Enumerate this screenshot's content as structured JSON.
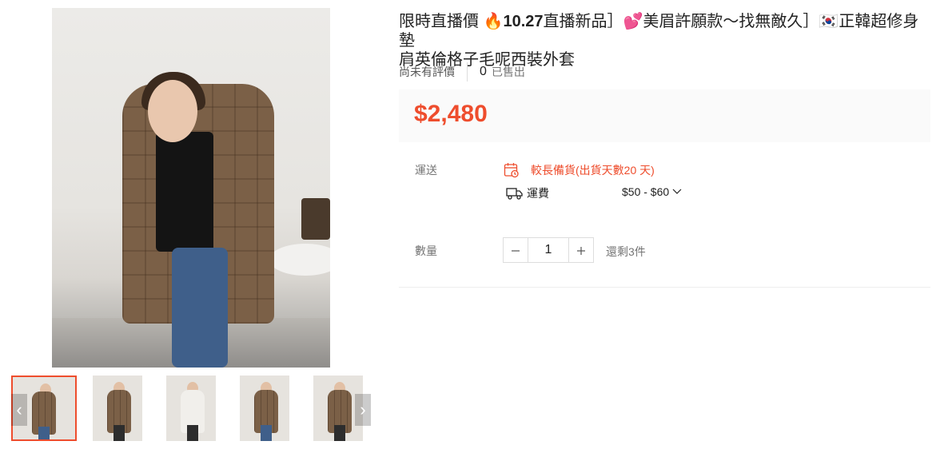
{
  "product": {
    "title_line1_prefix": "限時直播價 🔥",
    "title_line1_bold": "10.27",
    "title_line1_rest": "直播新品］💕美眉許願款〜找無敵久］🇰🇷正韓超修身墊",
    "title_line2": "肩英倫格子毛呢西裝外套"
  },
  "stats": {
    "no_review": "尚未有評價",
    "sold_count": "0",
    "sold_label": "已售出"
  },
  "price": "$2,480",
  "shipping": {
    "label": "運送",
    "long_prep": "較長備貨(出貨天數20 天)",
    "fee_label": "運費",
    "fee_range": "$50 - $60"
  },
  "quantity": {
    "label": "數量",
    "value": "1",
    "stock": "還剩3件"
  },
  "colors": {
    "accent": "#ee4d2d"
  }
}
